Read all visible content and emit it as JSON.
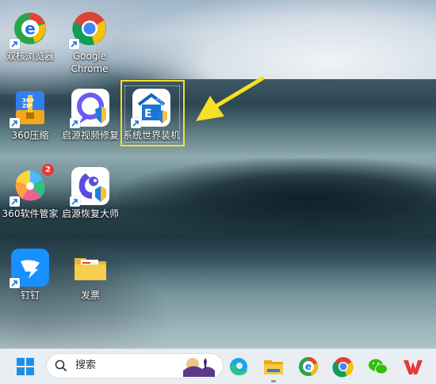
{
  "desktop": {
    "icons": [
      {
        "label": "双核浏览器",
        "icon": "dual-core-browser-icon"
      },
      {
        "label": "Google\nChrome",
        "icon": "chrome-icon"
      },
      {
        "label": "360压缩",
        "icon": "360-zip-icon"
      },
      {
        "label": "启源视频修复",
        "icon": "video-repair-icon"
      },
      {
        "label": "系统世界装机",
        "icon": "system-world-installer-icon"
      },
      {
        "label": "360软件管家",
        "icon": "360-software-manager-icon"
      },
      {
        "label": "启源恢复大师",
        "icon": "recovery-master-icon"
      },
      {
        "label": "钉钉",
        "icon": "dingtalk-icon"
      },
      {
        "label": "发票",
        "icon": "folder-icon"
      }
    ],
    "selected_icon": "系统世界装机",
    "badge_count": "2",
    "annotation": "yellow-arrow pointing to selected icon"
  },
  "taskbar": {
    "search_placeholder": "搜索",
    "apps": [
      "start-icon",
      "edge-icon",
      "file-explorer-icon",
      "dual-core-browser-icon",
      "chrome-icon",
      "wechat-icon",
      "wps-icon"
    ]
  },
  "colors": {
    "selection": "#f5e026",
    "arrow": "#f5e026",
    "taskbar": "#e9eef3"
  }
}
